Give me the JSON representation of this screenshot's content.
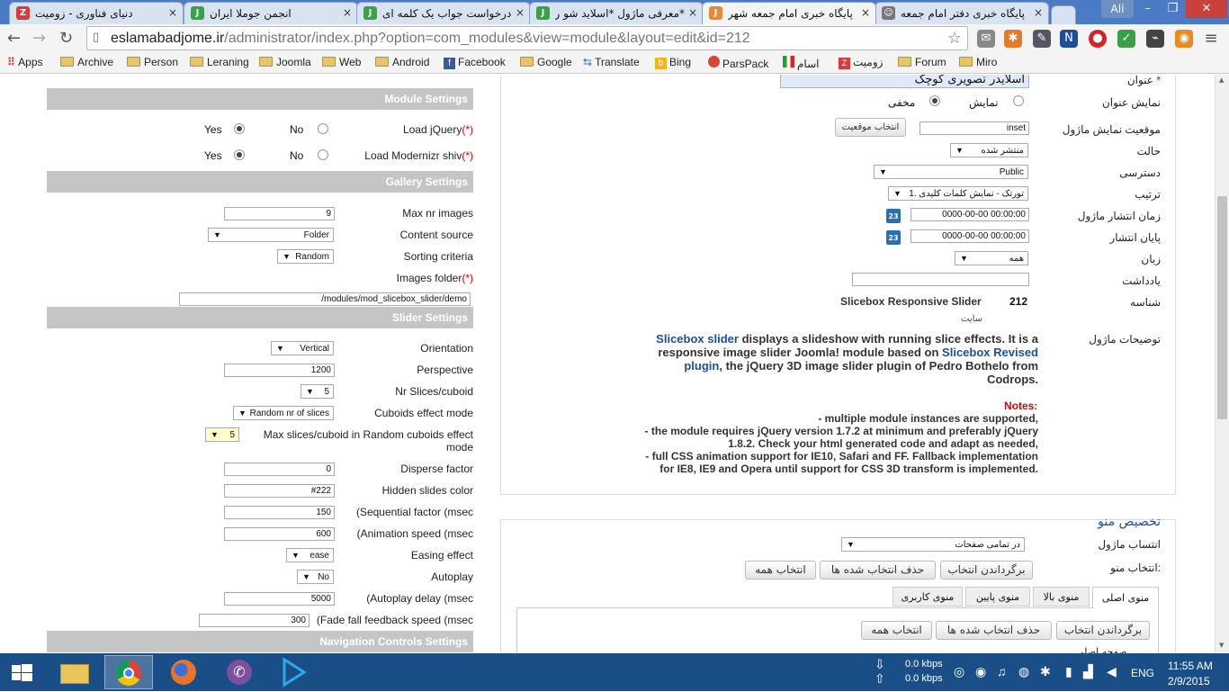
{
  "window": {
    "user_label": "Ali"
  },
  "tabs": [
    {
      "title": "دنیای فناوری - زومیت",
      "fav_color": "#d93a3a",
      "fav_text": "Z"
    },
    {
      "title": "انجمن جوملا ایران",
      "fav_color": "#3aa04a",
      "fav_text": "J"
    },
    {
      "title": "درخواست جواب یک کلمه ای",
      "fav_color": "#3aa04a",
      "fav_text": "J"
    },
    {
      "title": "*معرفی ماژول *اسلاید شو ر",
      "fav_color": "#3aa04a",
      "fav_text": "J"
    },
    {
      "title": "پایگاه خبری امام جمعه شهر",
      "fav_color": "#e8873a",
      "fav_text": "J"
    },
    {
      "title": "پایگاه خبری دفتر امام جمعه",
      "fav_color": "#777777",
      "fav_text": "☺"
    }
  ],
  "address": {
    "domain": "eslamabadjome.ir",
    "path": "/administrator/index.php?option=com_modules&view=module&layout=edit&id=212"
  },
  "bookmarks": [
    "Apps",
    "Archive",
    "Person",
    "Leraning",
    "Joomla",
    "Web",
    "Android",
    "Facebook",
    "Google",
    "Translate",
    "Bing",
    "ParsPack",
    "اسام",
    "زومیت",
    "Forum",
    "Miro"
  ],
  "module_settings": {
    "header": "Module Settings",
    "load_jquery": {
      "label": "Load jQuery",
      "req": "(*)",
      "yes": "Yes",
      "no": "No"
    },
    "load_modernizr": {
      "label": "Load Modernizr shiv",
      "req": "(*)",
      "yes": "Yes",
      "no": "No"
    }
  },
  "gallery_settings": {
    "header": "Gallery Settings",
    "max_nr_images": {
      "label": "Max nr images",
      "value": "9"
    },
    "content_source": {
      "label": "Content source",
      "value": "Folder"
    },
    "sorting_criteria": {
      "label": "Sorting criteria",
      "value": "Random"
    },
    "images_folder": {
      "label": "Images folder",
      "req": "(*)",
      "value": "/modules/mod_slicebox_slider/demo"
    }
  },
  "slider_settings": {
    "header": "Slider Settings",
    "orientation": {
      "label": "Orientation",
      "value": "Vertical"
    },
    "perspective": {
      "label": "Perspective",
      "value": "1200"
    },
    "nr_slices": {
      "label": "Nr Slices/cuboid",
      "value": "5"
    },
    "cuboids_effect": {
      "label": "Cuboids effect mode",
      "value": "Random nr of slices"
    },
    "max_slices": {
      "label": "Max slices/cuboid in Random cuboids effect mode",
      "value": "5"
    },
    "disperse": {
      "label": "Disperse factor",
      "value": "0"
    },
    "hidden_color": {
      "label": "Hidden slides color",
      "value": "#222"
    },
    "sequential": {
      "label": "(Sequential factor (msec",
      "value": "150"
    },
    "animation_speed": {
      "label": "(Animation speed (msec",
      "value": "600"
    },
    "easing": {
      "label": "Easing effect",
      "value": "ease"
    },
    "autoplay": {
      "label": "Autoplay",
      "value": "No"
    },
    "autoplay_delay": {
      "label": "(Autoplay delay (msec",
      "value": "5000"
    },
    "fade_fall": {
      "label": "(Fade fall feedback speed (msec",
      "value": "300"
    }
  },
  "nav_settings": {
    "header": "Navigation Controls Settings"
  },
  "details": {
    "title_label": "عنوان",
    "title_value": "اسلایدر تصویری کوچک",
    "show_title": {
      "label": "نمایش عنوان",
      "show": "نمایش",
      "hide": "مخفی"
    },
    "position": {
      "label": "موقعیت نمایش ماژول",
      "value": "inset",
      "button": "انتخاب موقعیت"
    },
    "status": {
      "label": "حالت",
      "value": "منتشر شده"
    },
    "access": {
      "label": "دسترسی",
      "value": "Public"
    },
    "ordering": {
      "label": "ترتیب",
      "value": "1. تورتک - نمایش کلمات کلیدی"
    },
    "start_publish": {
      "label": "زمان انتشار ماژول",
      "value": "0000-00-00 00:00:00"
    },
    "finish_publish": {
      "label": "پایان انتشار",
      "value": "0000-00-00 00:00:00"
    },
    "language": {
      "label": "زبان",
      "value": "همه"
    },
    "note": {
      "label": "یادداشت"
    },
    "id": {
      "label": "شناسه",
      "value": "212",
      "module_name": "Slicebox Responsive Slider",
      "site": "سایت"
    },
    "description_label": "توضیحات ماژول",
    "desc_link1": "Slicebox slider",
    "desc_t1": "displays a slideshow with running slice effects. It is a",
    "desc_t2": "responsive image slider Joomla! module based on",
    "desc_link2": "Slicebox Revised",
    "desc_link3": "plugin",
    "desc_t3": ", the jQuery 3D image slider plugin of Pedro Bothelo from",
    "desc_t4": "Codrops.",
    "notes_label": "Notes:",
    "notes": [
      "- multiple module instances are supported,",
      "- the module requires jQuery version 1.7.2 at minimum and preferably jQuery",
      "1.8.2. Check your html generated code and adapt as needed,",
      "- full CSS animation support for IE10, Safari and FF. Fallback implementation",
      "for IE8, IE9 and Opera until support for CSS 3D transform is implemented."
    ]
  },
  "menu_assign": {
    "title": "تخصیص منو",
    "assign_label": "انتساب ماژول",
    "assign_value": "در تمامی صفحات",
    "select_label": "انتخاب منو:",
    "toggle": "برگرداندن انتخاب",
    "clear": "حذف انتخاب شده ها",
    "select_all": "انتخاب همه",
    "menu_tabs": [
      "منوی اصلی",
      "منوی بالا",
      "منوی پایین",
      "منوی کاربری"
    ],
    "partial_item": "صفحه اصلی"
  },
  "taskbar": {
    "net_up": "0.0 kbps",
    "net_down": "0.0 kbps",
    "lang": "ENG",
    "time": "11:55 AM",
    "date": "2/9/2015"
  }
}
